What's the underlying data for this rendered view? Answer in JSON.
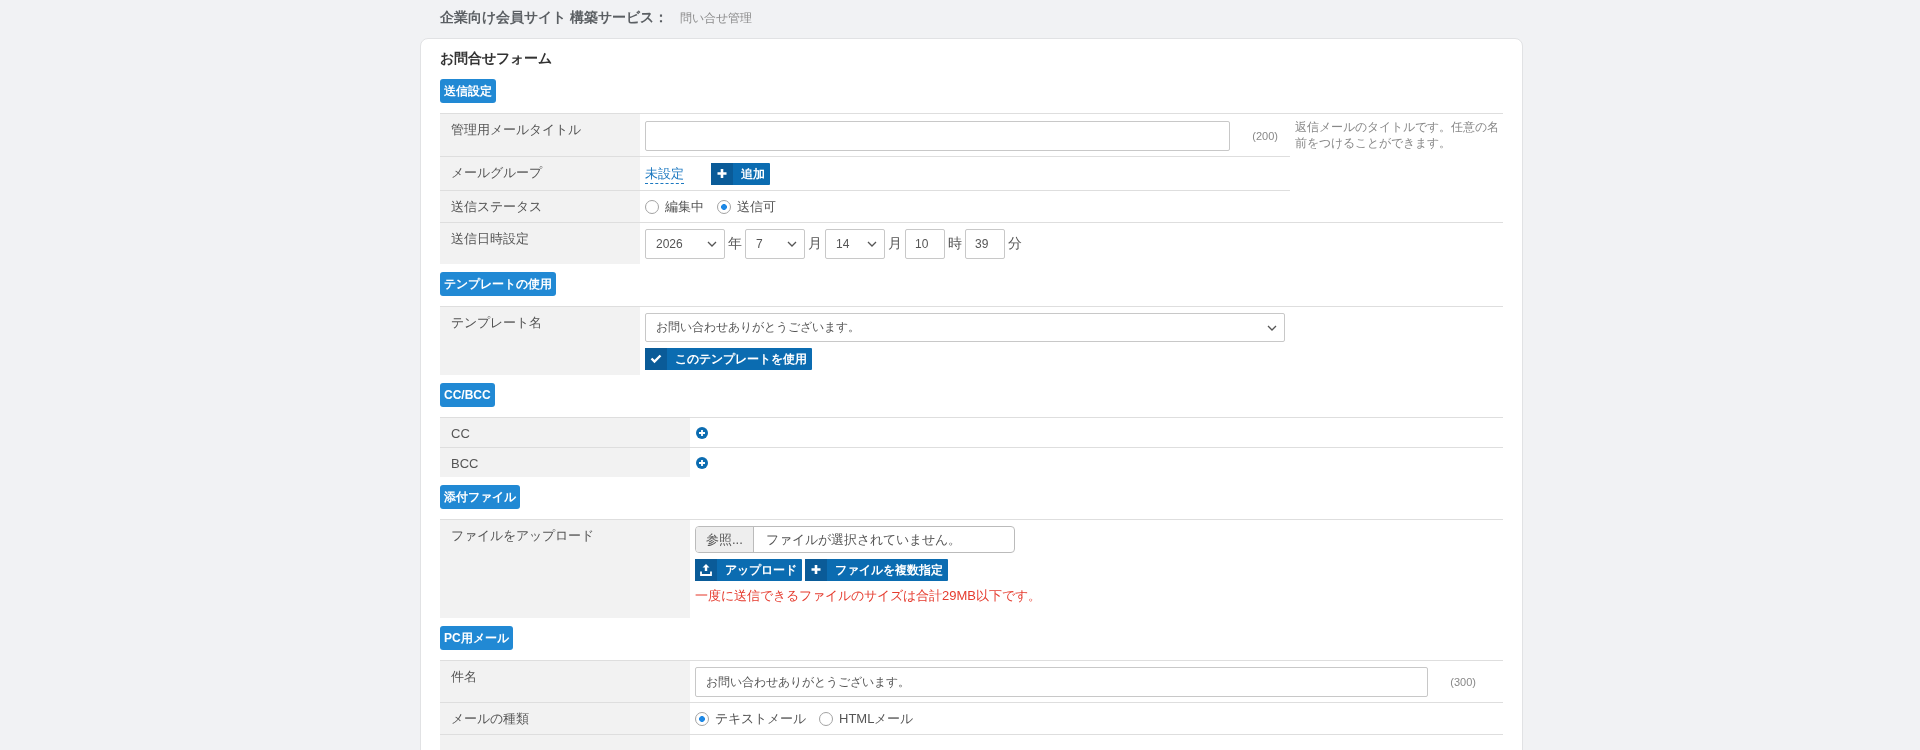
{
  "header": {
    "title": "企業向け会員サイト 構築サービス：",
    "breadcrumb": "問い合せ管理"
  },
  "form": {
    "title": "お問合せフォーム",
    "sections": [
      {
        "badge": "送信設定",
        "rows": [
          {
            "kind": "text",
            "label": "管理用メールタイトル",
            "count": "(200)",
            "help": "返信メールのタイトルです。任意の名前をつけることができます。"
          },
          {
            "kind": "group",
            "label": "メールグループ",
            "link": "未設定",
            "button": "追加"
          },
          {
            "kind": "radio",
            "label": "送信ステータス",
            "options": [
              {
                "label": "編集中",
                "selected": false
              },
              {
                "label": "送信可",
                "selected": true
              }
            ]
          },
          {
            "kind": "datetime",
            "label": "送信日時設定",
            "parts": [
              {
                "kind": "select",
                "value": "2026"
              },
              {
                "kind": "unit",
                "text": "年"
              },
              {
                "kind": "select",
                "value": "7"
              },
              {
                "kind": "unit",
                "text": "月"
              },
              {
                "kind": "select",
                "value": "14"
              },
              {
                "kind": "unit",
                "text": "月"
              },
              {
                "kind": "input",
                "value": "10"
              },
              {
                "kind": "unit",
                "text": "時"
              },
              {
                "kind": "input",
                "value": "39"
              },
              {
                "kind": "unit",
                "text": "分"
              }
            ]
          }
        ]
      },
      {
        "badge": "テンプレートの使用",
        "rows": [
          {
            "kind": "template",
            "label": "テンプレート名",
            "value": "お問い合わせありがとうございます。",
            "button": "このテンプレートを使用"
          }
        ]
      },
      {
        "badge": "CC/BCC",
        "rows": [
          {
            "kind": "add",
            "label": "CC"
          },
          {
            "kind": "add",
            "label": "BCC"
          }
        ]
      },
      {
        "badge": "添付ファイル",
        "rows": [
          {
            "kind": "upload",
            "label": "ファイルをアップロード",
            "browse": "参照...",
            "file_status": "ファイルが選択されていません。",
            "buttons": [
              {
                "kind": "upload",
                "label": "アップロード"
              },
              {
                "kind": "add",
                "label": "ファイルを複数指定"
              }
            ],
            "note": "一度に送信できるファイルのサイズは合計29MB以下です。"
          }
        ]
      },
      {
        "badge": "PC用メール",
        "rows": [
          {
            "kind": "text",
            "label": "件名",
            "value": "お問い合わせありがとうございます。",
            "count": "(300)"
          },
          {
            "kind": "radio",
            "label": "メールの種類",
            "options": [
              {
                "label": "テキストメール",
                "selected": true
              },
              {
                "label": "HTMLメール",
                "selected": false
              }
            ]
          },
          {
            "kind": "partial"
          }
        ]
      }
    ]
  }
}
